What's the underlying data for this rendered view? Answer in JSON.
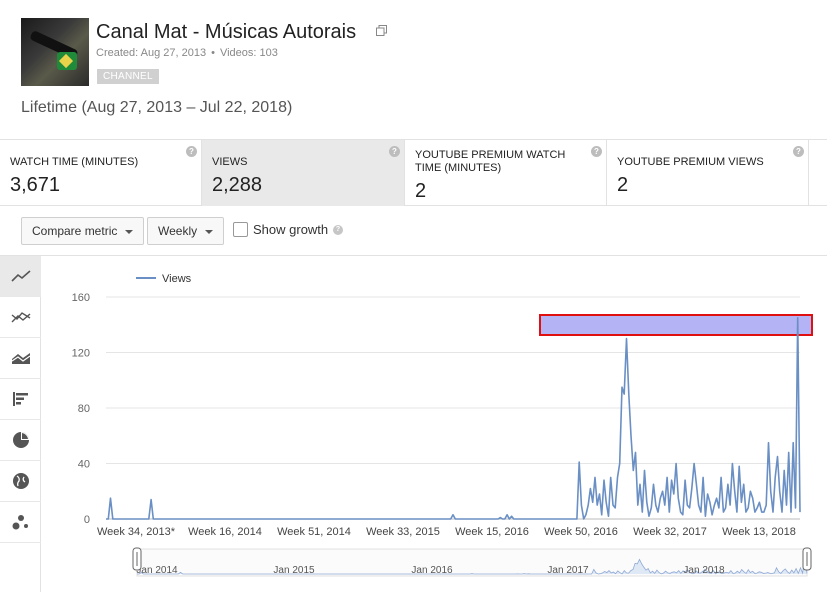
{
  "channel": {
    "title": "Canal Mat - Músicas Autorais",
    "created": "Created: Aug 27, 2013",
    "separator": "•",
    "videos": "Videos: 103",
    "badge": "CHANNEL"
  },
  "lifetime": "Lifetime (Aug 27, 2013 – Jul 22, 2018)",
  "metrics": [
    {
      "label": "WATCH TIME (MINUTES)",
      "value": "3,671"
    },
    {
      "label": "VIEWS",
      "value": "2,288"
    },
    {
      "label": "YOUTUBE PREMIUM WATCH TIME (MINUTES)",
      "value": "2"
    },
    {
      "label": "YOUTUBE PREMIUM VIEWS",
      "value": "2"
    }
  ],
  "controls": {
    "compare": "Compare metric",
    "interval": "Weekly",
    "show_growth": "Show growth",
    "show_growth_checked": false
  },
  "sidebar_icons": [
    "line-chart-icon",
    "multi-line-chart-icon",
    "stacked-area-chart-icon",
    "bar-chart-icon",
    "pie-chart-icon",
    "globe-map-icon",
    "bubble-chart-icon"
  ],
  "chart_data": {
    "type": "line",
    "legend": "Views",
    "ylim": [
      0,
      160
    ],
    "yticks": [
      "0",
      "40",
      "80",
      "120",
      "160"
    ],
    "x_tick_labels": [
      "Week 34, 2013*",
      "Week 16, 2014",
      "Week 51, 2014",
      "Week 33, 2015",
      "Week 15, 2016",
      "Week 50, 2016",
      "Week 32, 2017",
      "Week 13, 2018"
    ],
    "series": [
      {
        "name": "Views",
        "color": "#6a8fc4",
        "values": [
          0,
          0,
          15,
          0,
          0,
          0,
          0,
          0,
          0,
          0,
          0,
          0,
          0,
          0,
          0,
          0,
          0,
          0,
          0,
          0,
          14,
          0,
          0,
          0,
          0,
          0,
          0,
          0,
          0,
          0,
          0,
          0,
          0,
          0,
          0,
          0,
          0,
          0,
          0,
          0,
          0,
          0,
          0,
          0,
          0,
          0,
          0,
          0,
          0,
          0,
          0,
          0,
          0,
          0,
          0,
          0,
          0,
          0,
          0,
          0,
          0,
          0,
          0,
          0,
          0,
          0,
          0,
          0,
          0,
          0,
          0,
          0,
          0,
          0,
          0,
          0,
          0,
          0,
          0,
          0,
          0,
          0,
          0,
          0,
          0,
          0,
          0,
          0,
          0,
          0,
          0,
          0,
          0,
          0,
          0,
          0,
          0,
          0,
          0,
          0,
          0,
          0,
          0,
          0,
          0,
          0,
          0,
          0,
          0,
          0,
          0,
          0,
          0,
          0,
          0,
          0,
          0,
          0,
          0,
          0,
          0,
          0,
          0,
          0,
          0,
          0,
          0,
          0,
          0,
          0,
          0,
          0,
          0,
          0,
          0,
          0,
          0,
          0,
          0,
          0,
          0,
          0,
          0,
          0,
          0,
          0,
          0,
          0,
          0,
          0,
          0,
          0,
          0,
          0,
          3,
          0,
          0,
          0,
          0,
          0,
          0,
          0,
          0,
          0,
          0,
          0,
          0,
          0,
          0,
          0,
          0,
          0,
          0,
          0,
          0,
          1,
          0,
          0,
          3,
          0,
          2,
          0,
          0,
          0,
          0,
          0,
          0,
          0,
          0,
          0,
          0,
          0,
          0,
          0,
          0,
          0,
          0,
          0,
          0,
          0,
          0,
          0,
          0,
          0,
          0,
          0,
          0,
          0,
          0,
          0,
          41,
          10,
          0,
          3,
          10,
          22,
          12,
          30,
          10,
          18,
          3,
          28,
          12,
          2,
          30,
          10,
          8,
          30,
          40,
          95,
          90,
          130,
          90,
          60,
          35,
          48,
          10,
          25,
          5,
          35,
          12,
          2,
          8,
          25,
          10,
          5,
          15,
          20,
          10,
          30,
          5,
          28,
          18,
          40,
          15,
          5,
          3,
          28,
          10,
          8,
          22,
          40,
          25,
          10,
          5,
          30,
          2,
          18,
          12,
          3,
          10,
          15,
          8,
          30,
          5,
          8,
          25,
          10,
          40,
          20,
          5,
          38,
          12,
          25,
          5,
          8,
          20,
          15,
          5,
          8,
          12,
          5,
          5,
          10,
          55,
          20,
          5,
          30,
          45,
          20,
          5,
          35,
          10,
          48,
          5,
          55,
          8,
          145,
          5
        ],
        "highlight_peak": true
      }
    ],
    "range_selector": {
      "tick_labels": [
        "Jan 2014",
        "Jan 2015",
        "Jan 2016",
        "Jan 2017",
        "Jan 2018"
      ]
    }
  }
}
